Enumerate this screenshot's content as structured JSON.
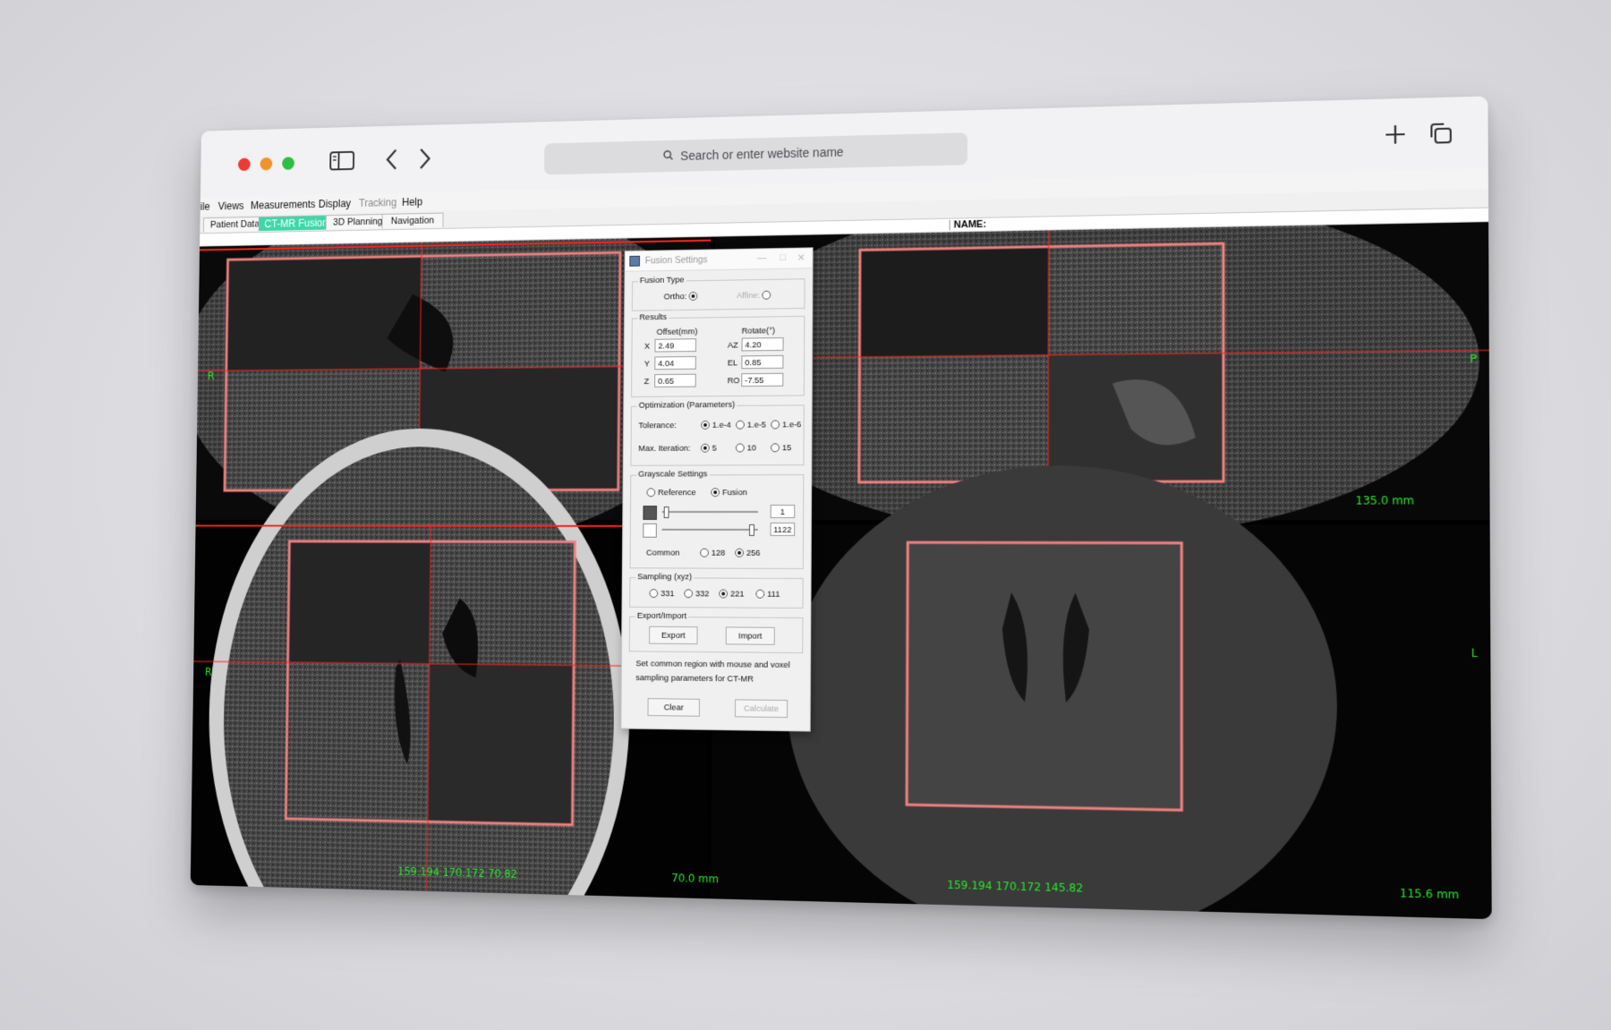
{
  "browser": {
    "search_placeholder": "Search or enter website name"
  },
  "menu": [
    "ile",
    "Views",
    "Measurements",
    "Display",
    "Tracking",
    "Help"
  ],
  "app_tabs": [
    "Patient Data",
    "CT-MR Fusion",
    "3D Planning",
    "Navigation"
  ],
  "name_label": "NAME:",
  "viewer": {
    "labels": {
      "tl_left": "R",
      "tr_right": "P",
      "tr_scale": "135.0 mm",
      "bl_left": "R",
      "bl_coords": "159.194  170.172  70.82",
      "bl_scale": "70.0 mm",
      "br_right": "L",
      "br_coords": "159.194  170.172  145.82",
      "br_scale": "115.6 mm"
    }
  },
  "dialog": {
    "title": "Fusion Settings",
    "fusion_type": {
      "label": "Fusion Type",
      "ortho": "Ortho:",
      "affine": "Affine:"
    },
    "results": {
      "label": "Results",
      "offset_header": "Offset(mm)",
      "rotate_header": "Rotate(°)",
      "x_label": "X",
      "x_value": "2.49",
      "y_label": "Y",
      "y_value": "4.04",
      "z_label": "Z",
      "z_value": "0.65",
      "az_label": "AZ",
      "az_value": "4.20",
      "el_label": "EL",
      "el_value": "0.85",
      "ro_label": "RO",
      "ro_value": "-7.55"
    },
    "optimization": {
      "label": "Optimization (Parameters)",
      "tolerance_label": "Tolerance:",
      "tol1": "1.e-4",
      "tol2": "1.e-5",
      "tol3": "1.e-6",
      "iter_label": "Max. Iteration:",
      "it1": "5",
      "it2": "10",
      "it3": "15"
    },
    "grayscale": {
      "label": "Grayscale Settings",
      "reference": "Reference",
      "fusion": "Fusion",
      "min_value": "1",
      "max_value": "1122",
      "common_label": "Common",
      "c1": "128",
      "c2": "256"
    },
    "sampling": {
      "label": "Sampling (xyz)",
      "s1": "331",
      "s2": "332",
      "s3": "221",
      "s4": "111"
    },
    "export_import": {
      "label": "Export/Import",
      "export": "Export",
      "import": "Import"
    },
    "hint_line1": "Set common region with mouse and voxel",
    "hint_line2": "sampling parameters for CT-MR",
    "clear": "Clear",
    "calculate": "Calculate"
  },
  "colors": {
    "roi_box": "#f08080",
    "crosshair": "#ff2020",
    "overlay_text": "#29e629",
    "active_tab": "#3fd6a8"
  }
}
